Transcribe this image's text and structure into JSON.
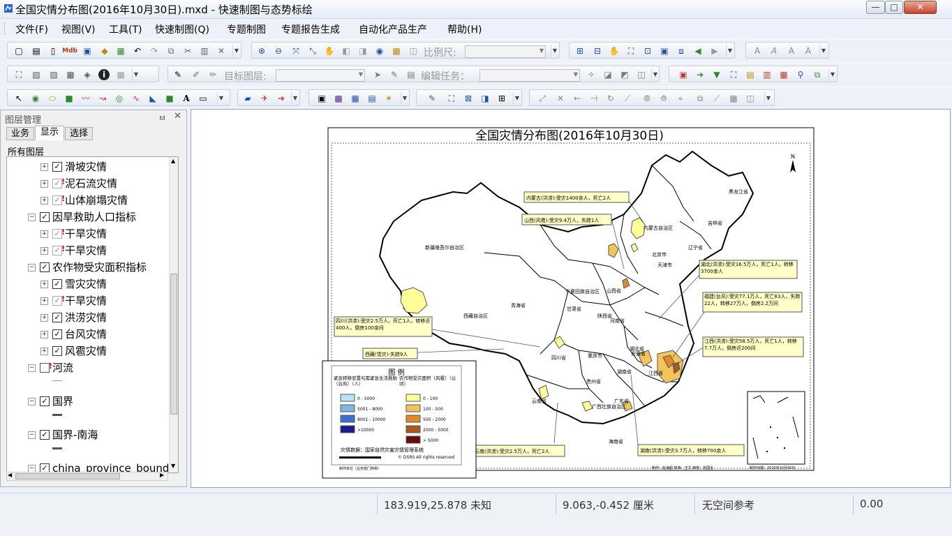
{
  "window": {
    "title": "全国灾情分布图(2016年10月30日).mxd - 快速制图与态势标绘",
    "min_glyph": "—",
    "max_glyph": "□",
    "close_glyph": "✕"
  },
  "menu": [
    "文件(F)",
    "视图(V)",
    "工具(T)",
    "快速制图(Q)",
    "专题制图",
    "专题报告生成",
    "自动化产品生产",
    "帮助(H)"
  ],
  "toolbar": {
    "scale_label": "比例尺:",
    "scale_value": "",
    "target_layer_label": "目标图层:",
    "target_layer_value": "",
    "edit_task_label": "编辑任务：",
    "edit_task_value": "",
    "text_tool_glyph": "A"
  },
  "layer_panel": {
    "title": "图层管理",
    "pin_glyph": "ㅂ",
    "close_glyph": "✕",
    "tabs": [
      "业务",
      "显示",
      "选择"
    ],
    "active_tab": "显示",
    "root_label": "所有图层",
    "items": [
      {
        "label": "滑坡灾情",
        "level": 2,
        "state": "checked"
      },
      {
        "label": "泥石流灾情",
        "level": 2,
        "state": "warn"
      },
      {
        "label": "山体崩塌灾情",
        "level": 2,
        "state": "warn"
      },
      {
        "label": "因旱救助人口指标",
        "level": 1,
        "state": "checked"
      },
      {
        "label": "干旱灾情",
        "level": 2,
        "state": "warn"
      },
      {
        "label": "干旱灾情",
        "level": 2,
        "state": "warn"
      },
      {
        "label": "农作物受灾面积指标",
        "level": 1,
        "state": "checked"
      },
      {
        "label": "雪灾灾情",
        "level": 2,
        "state": "checked"
      },
      {
        "label": "干旱灾情",
        "level": 2,
        "state": "warn"
      },
      {
        "label": "洪涝灾情",
        "level": 2,
        "state": "checked"
      },
      {
        "label": "台风灾情",
        "level": 2,
        "state": "checked"
      },
      {
        "label": "风雹灾情",
        "level": 2,
        "state": "checked"
      },
      {
        "label": "河流",
        "level": 1,
        "state": "off"
      },
      {
        "label": "国界",
        "level": 1,
        "state": "checked"
      },
      {
        "label": "国界-南海",
        "level": 1,
        "state": "checked"
      },
      {
        "label": "china_province_bound",
        "level": 1,
        "state": "checked"
      }
    ]
  },
  "map": {
    "title": "全国灾情分布图(2016年10月30日)",
    "north": "N",
    "provinces": [
      "黑龙江省",
      "吉林省",
      "辽宁省",
      "内蒙古自治区",
      "新疆维吾尔自治区",
      "宁夏回族自治区",
      "青海省",
      "甘肃省",
      "西藏自治区",
      "四川省",
      "陕西省",
      "山西省",
      "河南省",
      "湖北省",
      "安徽省",
      "重庆市",
      "贵州省",
      "云南省",
      "湖南省",
      "江西省",
      "广西壮族自治区",
      "广东省",
      "海南省",
      "北京市",
      "天津市"
    ],
    "callouts": [
      "内蒙古(洪涝):受灾1400余人，死亡2人",
      "山西(风雹):受灾9.4万人，失踪1人",
      "湖北(洪涝):受灾16.5万人，死亡1人，转移3700余人",
      "福建(台风):受灾77.1万人，死亡83人，失踪22人，转移27万人，倒房2.2万间",
      "四川(洪涝):受灾2.5万人，死亡1人，转移近400人，倒房100余间",
      "西藏(雪灾):失踪9人",
      "江西(洪涝):受灾58.5万人，死亡1人，转移7.7万人，倒房近200间",
      "云南(洪涝):受灾2.5万人，死亡2人",
      "湖南(洪涝):受灾3.7万人，转移700余人"
    ],
    "legend": {
      "title": "图 例",
      "col1_title": "紧急转移安置与需紧急生活救助（台风）（人）",
      "col2_title": "农作物受灾面积（风雹）（公顷）",
      "col1": [
        {
          "label": "0 - 5000",
          "color": "#b9e3f0"
        },
        {
          "label": "5001 - 8000",
          "color": "#7fb6e6"
        },
        {
          "label": "8001 - 10000",
          "color": "#3b6fd1"
        },
        {
          "label": ">10000",
          "color": "#1a1a8a"
        }
      ],
      "col2": [
        {
          "label": "0 - 100",
          "color": "#ffff99"
        },
        {
          "label": "100 - 500",
          "color": "#f2c45a"
        },
        {
          "label": "500 - 2000",
          "color": "#e08a2a"
        },
        {
          "label": "2000 - 5000",
          "color": "#a85a1e"
        },
        {
          "label": "> 5000",
          "color": "#6b0a0a"
        }
      ],
      "source": "灾情数据：国家自然灾害灾情管理系统",
      "copyright": "© DSRS All rights reserved",
      "producer": "制作单位（业务部门简称）"
    },
    "footer_left": "制作：赵海超  核准：王文  审核：张国全",
    "footer_right": "制作日期：2016年10月30日"
  },
  "status": {
    "coords_geo": "183.919,25.878 未知",
    "coords_page": "9.063,-0.452 厘米",
    "spatial_ref": "无空间参考",
    "value": "0.00"
  }
}
